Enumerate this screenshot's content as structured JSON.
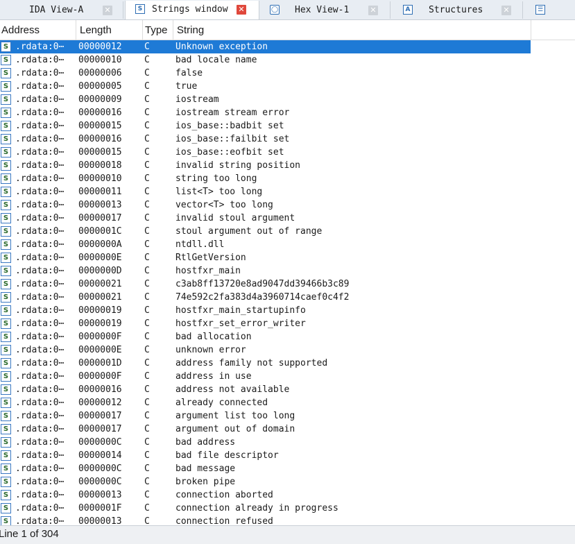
{
  "tabs": [
    {
      "label": "IDA View-A",
      "icon": "disassembly-icon",
      "active": false
    },
    {
      "label": "Strings window",
      "icon": "strings-icon",
      "active": true
    },
    {
      "label": "Hex View-1",
      "icon": "hex-view-icon",
      "active": false
    },
    {
      "label": "Structures",
      "icon": "structures-icon",
      "active": false
    },
    {
      "label": "",
      "icon": "enums-icon",
      "active": false
    }
  ],
  "columns": [
    "Address",
    "Length",
    "Type",
    "String"
  ],
  "rows": [
    {
      "address": ".rdata:0⋯",
      "length": "00000012",
      "type": "C",
      "string": "Unknown exception"
    },
    {
      "address": ".rdata:0⋯",
      "length": "00000010",
      "type": "C",
      "string": "bad locale name"
    },
    {
      "address": ".rdata:0⋯",
      "length": "00000006",
      "type": "C",
      "string": "false"
    },
    {
      "address": ".rdata:0⋯",
      "length": "00000005",
      "type": "C",
      "string": "true"
    },
    {
      "address": ".rdata:0⋯",
      "length": "00000009",
      "type": "C",
      "string": "iostream"
    },
    {
      "address": ".rdata:0⋯",
      "length": "00000016",
      "type": "C",
      "string": "iostream stream error"
    },
    {
      "address": ".rdata:0⋯",
      "length": "00000015",
      "type": "C",
      "string": "ios_base::badbit set"
    },
    {
      "address": ".rdata:0⋯",
      "length": "00000016",
      "type": "C",
      "string": "ios_base::failbit set"
    },
    {
      "address": ".rdata:0⋯",
      "length": "00000015",
      "type": "C",
      "string": "ios_base::eofbit set"
    },
    {
      "address": ".rdata:0⋯",
      "length": "00000018",
      "type": "C",
      "string": "invalid string position"
    },
    {
      "address": ".rdata:0⋯",
      "length": "00000010",
      "type": "C",
      "string": "string too long"
    },
    {
      "address": ".rdata:0⋯",
      "length": "00000011",
      "type": "C",
      "string": "list<T> too long"
    },
    {
      "address": ".rdata:0⋯",
      "length": "00000013",
      "type": "C",
      "string": "vector<T> too long"
    },
    {
      "address": ".rdata:0⋯",
      "length": "00000017",
      "type": "C",
      "string": "invalid stoul argument"
    },
    {
      "address": ".rdata:0⋯",
      "length": "0000001C",
      "type": "C",
      "string": "stoul argument out of range"
    },
    {
      "address": ".rdata:0⋯",
      "length": "0000000A",
      "type": "C",
      "string": "ntdll.dll"
    },
    {
      "address": ".rdata:0⋯",
      "length": "0000000E",
      "type": "C",
      "string": "RtlGetVersion"
    },
    {
      "address": ".rdata:0⋯",
      "length": "0000000D",
      "type": "C",
      "string": "hostfxr_main"
    },
    {
      "address": ".rdata:0⋯",
      "length": "00000021",
      "type": "C",
      "string": "c3ab8ff13720e8ad9047dd39466b3c89"
    },
    {
      "address": ".rdata:0⋯",
      "length": "00000021",
      "type": "C",
      "string": "74e592c2fa383d4a3960714caef0c4f2"
    },
    {
      "address": ".rdata:0⋯",
      "length": "00000019",
      "type": "C",
      "string": "hostfxr_main_startupinfo"
    },
    {
      "address": ".rdata:0⋯",
      "length": "00000019",
      "type": "C",
      "string": "hostfxr_set_error_writer"
    },
    {
      "address": ".rdata:0⋯",
      "length": "0000000F",
      "type": "C",
      "string": "bad allocation"
    },
    {
      "address": ".rdata:0⋯",
      "length": "0000000E",
      "type": "C",
      "string": "unknown error"
    },
    {
      "address": ".rdata:0⋯",
      "length": "0000001D",
      "type": "C",
      "string": "address family not supported"
    },
    {
      "address": ".rdata:0⋯",
      "length": "0000000F",
      "type": "C",
      "string": "address in use"
    },
    {
      "address": ".rdata:0⋯",
      "length": "00000016",
      "type": "C",
      "string": "address not available"
    },
    {
      "address": ".rdata:0⋯",
      "length": "00000012",
      "type": "C",
      "string": "already connected"
    },
    {
      "address": ".rdata:0⋯",
      "length": "00000017",
      "type": "C",
      "string": "argument list too long"
    },
    {
      "address": ".rdata:0⋯",
      "length": "00000017",
      "type": "C",
      "string": "argument out of domain"
    },
    {
      "address": ".rdata:0⋯",
      "length": "0000000C",
      "type": "C",
      "string": "bad address"
    },
    {
      "address": ".rdata:0⋯",
      "length": "00000014",
      "type": "C",
      "string": "bad file descriptor"
    },
    {
      "address": ".rdata:0⋯",
      "length": "0000000C",
      "type": "C",
      "string": "bad message"
    },
    {
      "address": ".rdata:0⋯",
      "length": "0000000C",
      "type": "C",
      "string": "broken pipe"
    },
    {
      "address": ".rdata:0⋯",
      "length": "00000013",
      "type": "C",
      "string": "connection aborted"
    },
    {
      "address": ".rdata:0⋯",
      "length": "0000001F",
      "type": "C",
      "string": "connection already in progress"
    },
    {
      "address": ".rdata:0⋯",
      "length": "00000013",
      "type": "C",
      "string": "connection refused"
    }
  ],
  "selected_row": 0,
  "status": {
    "text": "Line 1 of 304"
  },
  "colors": {
    "selection": "#1e7ad6",
    "active_close": "#e0483c",
    "tabbar": "#e8edf3"
  }
}
